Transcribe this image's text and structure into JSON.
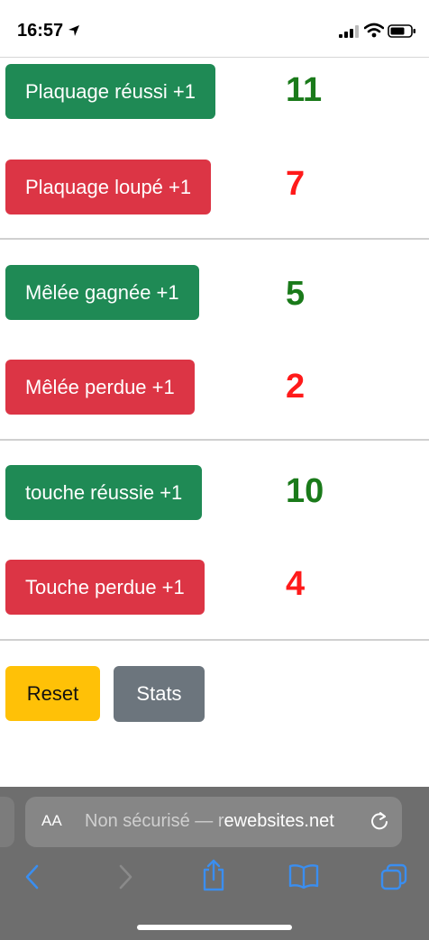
{
  "status": {
    "time": "16:57"
  },
  "stats": [
    {
      "label": "Plaquage réussi +1",
      "count": "11",
      "kind": "good"
    },
    {
      "label": "Plaquage loupé +1",
      "count": "7",
      "kind": "bad"
    },
    {
      "label": "Mêlée gagnée +1",
      "count": "5",
      "kind": "good"
    },
    {
      "label": "Mêlée perdue +1",
      "count": "2",
      "kind": "bad"
    },
    {
      "label": "touche réussie +1",
      "count": "10",
      "kind": "good"
    },
    {
      "label": "Touche perdue +1",
      "count": "4",
      "kind": "bad"
    }
  ],
  "actions": {
    "reset_label": "Reset",
    "stats_label": "Stats"
  },
  "browser": {
    "aa_label": "AA",
    "url_prefix": "Non sécurisé — r",
    "url_domain": "ewebsites.net"
  },
  "colors": {
    "success": "#1f8a55",
    "danger": "#dc3545",
    "warning": "#ffc107",
    "secondary": "#6c757d",
    "count_good": "#1a7a1a",
    "count_bad": "#ff1a1a"
  },
  "icons": [
    "location-arrow-icon",
    "signal-icon",
    "wifi-icon",
    "battery-icon",
    "reload-icon",
    "back-icon",
    "forward-icon",
    "share-icon",
    "bookmarks-icon",
    "tabs-icon"
  ]
}
